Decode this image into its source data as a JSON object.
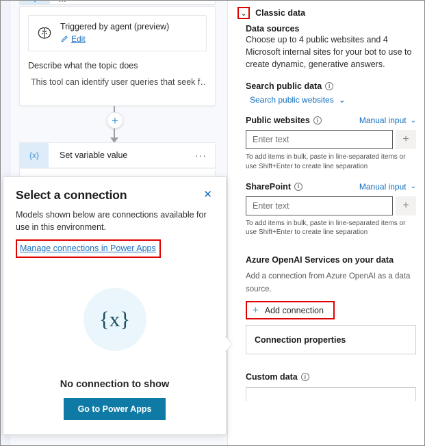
{
  "canvas": {
    "partial_node": {
      "icon": "↓",
      "label": "…"
    },
    "topic_card": {
      "trigger_icon": "brain-icon",
      "trigger_title": "Triggered by agent (preview)",
      "edit_label": "Edit",
      "describe_label": "Describe what the topic does",
      "describe_value": "This tool can identify user queries that seek f…"
    },
    "add_node_plus": "+",
    "set_variable_node": {
      "icon": "{x}",
      "label": "Set variable value",
      "overflow": "···"
    }
  },
  "dialog": {
    "title": "Select a connection",
    "close_label": "✕",
    "subtitle": "Models shown below are connections available for use in this environment.",
    "manage_link": "Manage connections in Power Apps",
    "empty_icon": "{x}",
    "empty_text": "No connection to show",
    "primary_button": "Go to Power Apps",
    "highlight_color": "#e00000",
    "button_color": "#0f7aa5",
    "link_color": "#1b6fbf"
  },
  "panel": {
    "section_title": "Classic data",
    "section_chevron": "⌄",
    "data_sources_heading": "Data sources",
    "data_sources_desc": "Choose up to 4 public websites and 4 Microsoft internal sites for your bot to use to create dynamic, generative answers.",
    "search_public_data": {
      "label": "Search public data",
      "info": "ⓘ",
      "dropdown_value": "Search public websites",
      "chevron": "⌄"
    },
    "public_websites": {
      "label": "Public websites",
      "info": "ⓘ",
      "mode": "Manual input",
      "chevron": "⌄",
      "placeholder": "Enter text",
      "value": "",
      "add_button": "+",
      "hint": "To add items in bulk, paste in line-separated items or use Shift+Enter to create line separation"
    },
    "sharepoint": {
      "label": "SharePoint",
      "info": "ⓘ",
      "mode": "Manual input",
      "chevron": "⌄",
      "placeholder": "Enter text",
      "value": "",
      "add_button": "+",
      "hint": "To add items in bulk, paste in line-separated items or use Shift+Enter to create line separation"
    },
    "azure": {
      "heading": "Azure OpenAI Services on your data",
      "desc": "Add a connection from Azure OpenAI as a data source.",
      "add_connection_plus": "+",
      "add_connection_label": "Add connection",
      "connection_properties": "Connection properties"
    },
    "custom_data": {
      "label": "Custom data",
      "info": "ⓘ"
    }
  }
}
